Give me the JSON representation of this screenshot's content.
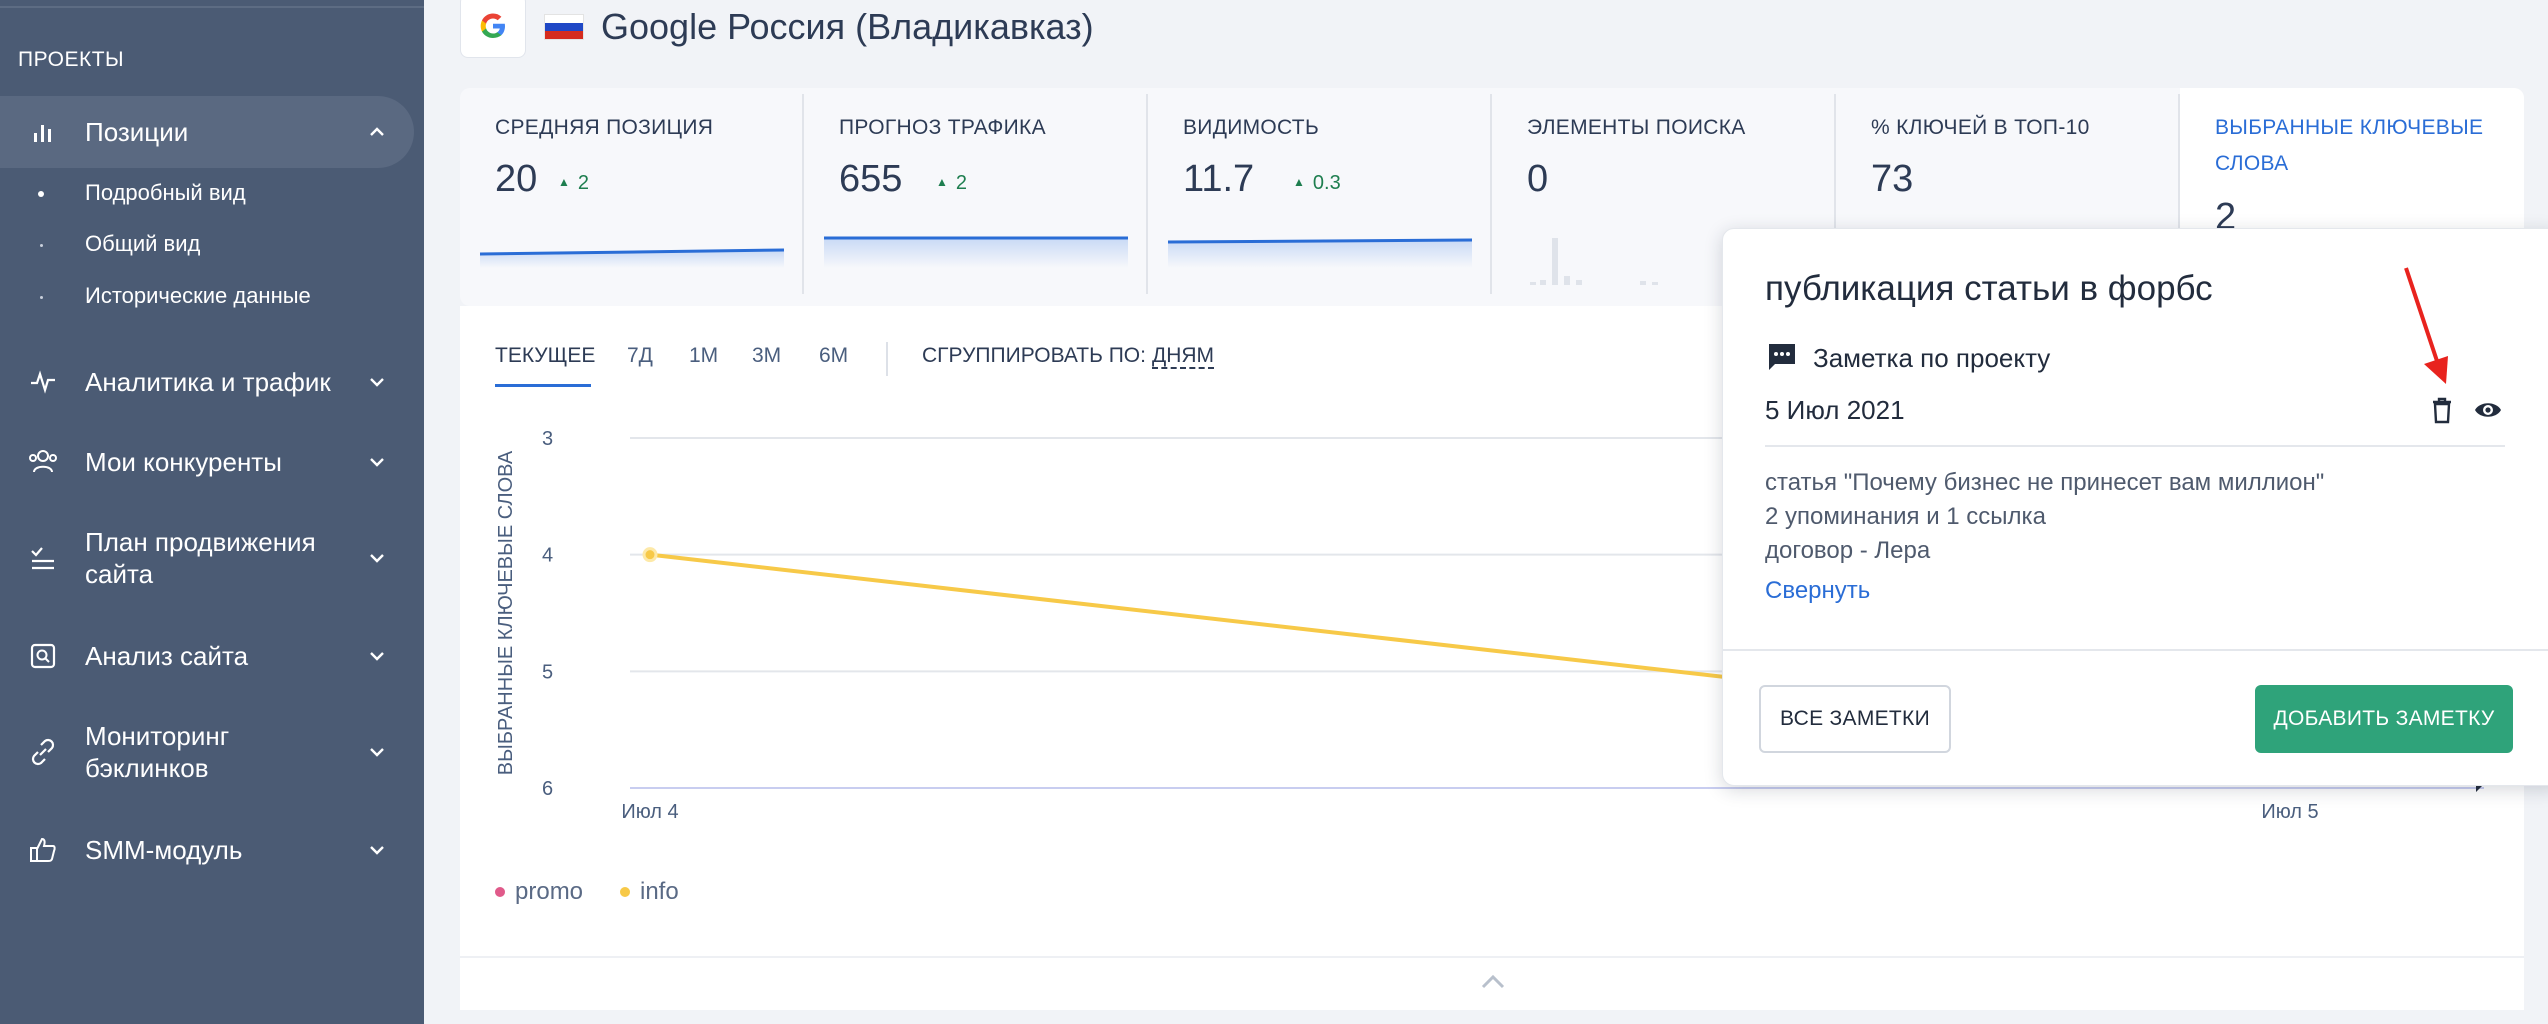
{
  "sidebar": {
    "section": "ПРОЕКТЫ",
    "items": [
      {
        "label": "Позиции",
        "icon": "bar-chart-icon"
      },
      {
        "label": "Аналитика и трафик",
        "icon": "pulse-icon"
      },
      {
        "label": "Мои конкуренты",
        "icon": "users-icon"
      },
      {
        "label": "План продвижения сайта",
        "icon": "checklist-icon"
      },
      {
        "label": "Анализ сайта",
        "icon": "site-search-icon"
      },
      {
        "label": "Мониторинг бэклинков",
        "icon": "link-icon"
      },
      {
        "label": "SMM-модуль",
        "icon": "thumb-up-icon"
      }
    ],
    "subitems": [
      "Подробный вид",
      "Общий вид",
      "Исторические данные"
    ]
  },
  "header": {
    "title": "Google Россия (Владикавказ)",
    "flag_colors": [
      "#ffffff",
      "#1f48c6",
      "#d52b1e"
    ]
  },
  "metrics": [
    {
      "title": "СРЕДНЯЯ ПОЗИЦИЯ",
      "value": "20",
      "delta": "2"
    },
    {
      "title": "ПРОГНОЗ ТРАФИКА",
      "value": "655",
      "delta": "2"
    },
    {
      "title": "ВИДИМОСТЬ",
      "value": "11.7",
      "delta": "0.3"
    },
    {
      "title": "ЭЛЕМЕНТЫ ПОИСКА",
      "value": "0",
      "delta": ""
    },
    {
      "title": "% КЛЮЧЕЙ В ТОП-10",
      "value": "73",
      "delta": ""
    },
    {
      "title": "ВЫБРАННЫЕ КЛЮЧЕВЫЕ СЛОВА",
      "value": "2",
      "delta": ""
    }
  ],
  "tabs": [
    "ТЕКУЩЕЕ",
    "7Д",
    "1М",
    "3М",
    "6М"
  ],
  "group": {
    "label": "СГРУППИРОВАТЬ ПО:",
    "value": "ДНЯМ"
  },
  "chart_data": {
    "type": "line",
    "ylabel": "ВЫБРАННЫЕ КЛЮЧЕВЫЕ СЛОВА",
    "y_ticks": [
      "3",
      "4",
      "5",
      "6"
    ],
    "ylim": [
      3,
      6
    ],
    "y_inverted": true,
    "x_ticks": [
      "Июл 4",
      "Июл 5"
    ],
    "series": [
      {
        "name": "promo",
        "color": "#e05a8a",
        "values": []
      },
      {
        "name": "info",
        "color": "#f7c948",
        "values": [
          4,
          5.6
        ]
      }
    ]
  },
  "popup": {
    "title": "публикация статьи в форбс",
    "type": "Заметка по проекту",
    "date": "5 Июл 2021",
    "lines": [
      "статья \"Почему бизнес не принесет вам миллион\"",
      "2 упоминания и 1 ссылка",
      "договор - Лера"
    ],
    "collapse": "Свернуть",
    "all_notes": "ВСЕ ЗАМЕТКИ",
    "add_note": "ДОБАВИТЬ ЗАМЕТКУ"
  }
}
